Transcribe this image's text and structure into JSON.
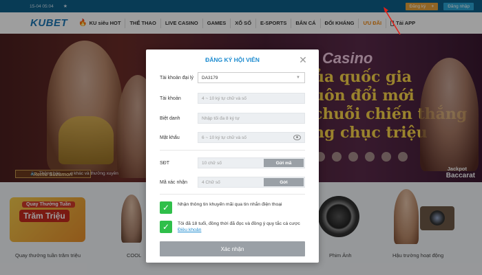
{
  "topbar": {
    "datetime": "15-04 05:04",
    "star": "★",
    "register_label": "Đăng ký",
    "register_plus": "+",
    "login_label": "Đăng nhập"
  },
  "nav": {
    "logo_ku": "KU",
    "logo_bet": "BET",
    "items": [
      {
        "label": "KU siêu HOT"
      },
      {
        "label": "THỂ THAO"
      },
      {
        "label": "LIVE CASINO"
      },
      {
        "label": "GAMES"
      },
      {
        "label": "XỔ SỐ"
      },
      {
        "label": "E-SPORTS"
      },
      {
        "label": "BẮN CÁ"
      },
      {
        "label": "ĐỐI KHÁNG"
      },
      {
        "label": "ƯU ĐÃI"
      },
      {
        "label": "Tải APP"
      }
    ]
  },
  "banner": {
    "name_tag": "Remu Suzumori",
    "casino_text": "Casino",
    "promo_lines": [
      "ủa quốc gia",
      "uôn đổi mới",
      "chuỗi chiến thắng",
      "ng chục triệu"
    ],
    "jackpot_line1": "Jackpot",
    "jackpot_line2": "Baccarat",
    "ticker_label": "Thông báo",
    "ticker_msg": "o khác và thưởng xuyên"
  },
  "tiles": [
    {
      "label": "Quay thưởng tuần trăm triệu"
    },
    {
      "label": "COOL"
    },
    {
      "label": "Phim Ảnh"
    },
    {
      "label": "Hậu trường hoạt động"
    }
  ],
  "quay_card": {
    "line1": "Quay Thưởng Tuần",
    "line2": "Trăm Triệu"
  },
  "modal": {
    "title": "ĐĂNG KÝ HỘI VIÊN",
    "close": "✕",
    "agent_label": "Tài khoản đại lý",
    "agent_value": "DA3179",
    "account_label": "Tài khoản",
    "account_placeholder": "4 ~ 10 ký tự chữ và số",
    "nickname_label": "Biệt danh",
    "nickname_placeholder": "Nhập tối đa 8 ký tự",
    "password_label": "Mật khẩu",
    "password_placeholder": "6 ~ 10 ký tự chữ và số",
    "phone_label": "SĐT",
    "phone_placeholder": "10 chữ số",
    "send_code_label": "Gửi mã",
    "verify_label": "Mã xác nhận",
    "verify_placeholder": "4 Chữ số",
    "send_label": "Gởi",
    "promo_check": "Nhận thông tin khuyến mãi qua tin nhắn điện thoại",
    "age_check_prefix": "Tôi đã 18 tuổi, đồng thời đã đọc và đồng ý quy tắc cá cược",
    "terms_link": "Điều khoản",
    "submit_label": "Xác nhận"
  }
}
